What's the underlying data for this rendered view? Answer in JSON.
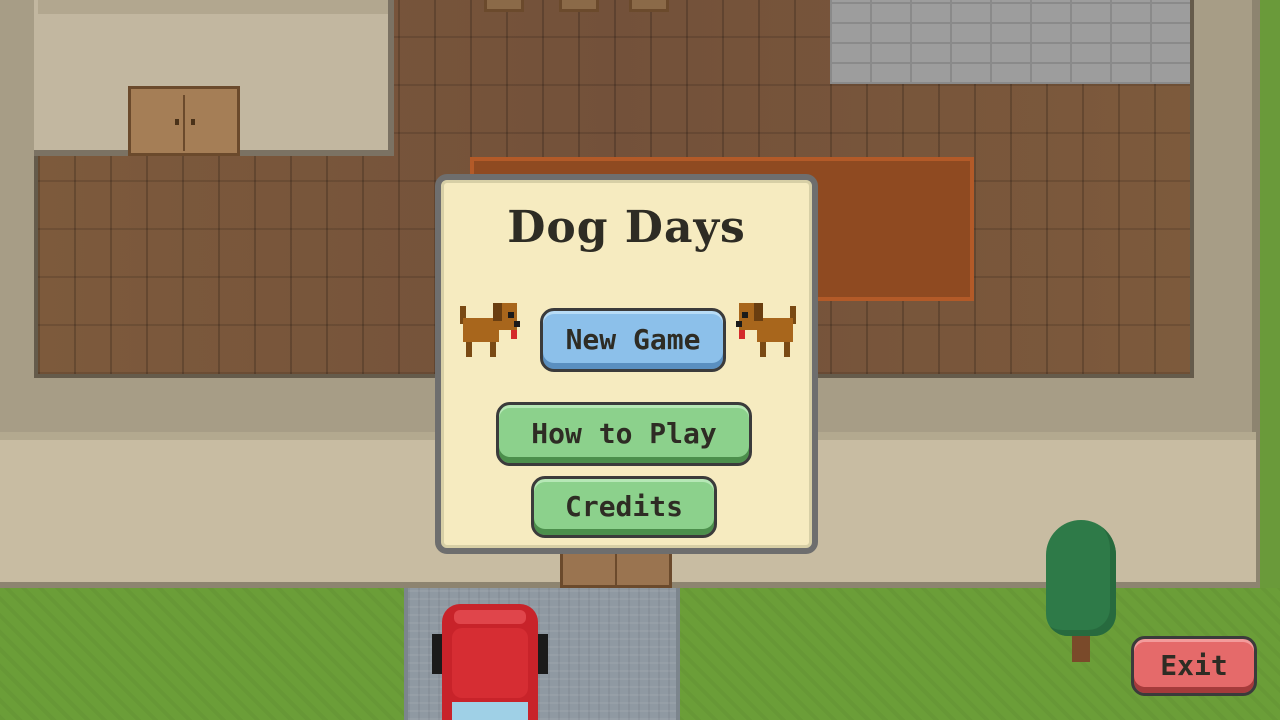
{
  "menu": {
    "title": "Dog Days",
    "new_game_label": "New Game",
    "how_to_play_label": "How to Play",
    "credits_label": "Credits"
  },
  "hud": {
    "exit_label": "Exit"
  },
  "colors": {
    "panel_bg": "#f6ebc0",
    "panel_border": "#6e6e6e",
    "primary_button": "#8cc0ea",
    "secondary_button": "#8cd18c",
    "exit_button": "#e56a6a",
    "floor": "#7a5638",
    "grass": "#6b9e38"
  },
  "icons": [
    "dog-icon-left",
    "dog-icon-right"
  ]
}
